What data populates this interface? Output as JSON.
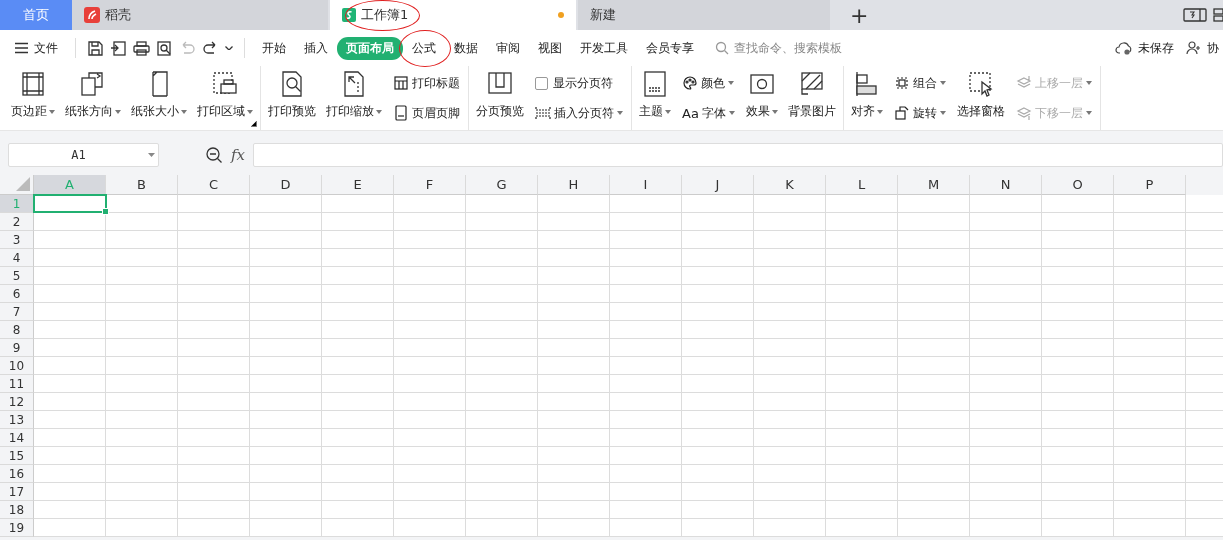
{
  "tabs": [
    {
      "kind": "home",
      "label": "首页",
      "selected": false
    },
    {
      "kind": "app",
      "label": "稻壳",
      "selected": false
    },
    {
      "kind": "doc",
      "label": "工作簿1",
      "selected": true,
      "circled": true,
      "unsaved": true
    },
    {
      "kind": "plain",
      "label": "新建",
      "selected": false
    }
  ],
  "new_tab_button": "+",
  "menu": {
    "file": "文件",
    "quick_access": [
      {
        "disabled": false
      },
      {
        "disabled": false
      },
      {
        "disabled": false
      },
      {
        "disabled": false
      },
      {
        "disabled": true
      },
      {
        "disabled": false
      },
      {
        "disabled": false
      }
    ],
    "items": [
      {
        "label": "开始",
        "selected": false,
        "circled": false
      },
      {
        "label": "插入",
        "selected": false,
        "circled": false
      },
      {
        "label": "页面布局",
        "selected": true,
        "circled": false
      },
      {
        "label": "公式",
        "selected": false,
        "circled": true
      },
      {
        "label": "数据",
        "selected": false,
        "circled": false
      },
      {
        "label": "审阅",
        "selected": false,
        "circled": false
      },
      {
        "label": "视图",
        "selected": false,
        "circled": false
      },
      {
        "label": "开发工具",
        "selected": false,
        "circled": false
      },
      {
        "label": "会员专享",
        "selected": false,
        "circled": false
      }
    ],
    "search": {
      "placeholder": "查找命令、搜索模板"
    },
    "save_status": "未保存",
    "share": "协"
  },
  "ribbon": [
    {
      "launcher": true,
      "items": [
        {
          "kind": "large",
          "label": "页边距",
          "dropdown": true
        },
        {
          "kind": "large",
          "label": "纸张方向",
          "dropdown": true
        },
        {
          "kind": "large",
          "label": "纸张大小",
          "dropdown": true
        },
        {
          "kind": "large",
          "label": "打印区域",
          "dropdown": true
        }
      ]
    },
    {
      "items": [
        {
          "kind": "large",
          "label": "打印预览",
          "dropdown": false
        },
        {
          "kind": "large",
          "label": "打印缩放",
          "dropdown": true
        },
        {
          "kind": "stack",
          "items": [
            {
              "kind": "small",
              "label": "打印标题",
              "dropdown": false,
              "disabled": false
            },
            {
              "kind": "small",
              "label": "页眉页脚",
              "dropdown": false,
              "disabled": false
            }
          ]
        }
      ]
    },
    {
      "items": [
        {
          "kind": "large",
          "label": "分页预览",
          "dropdown": false
        },
        {
          "kind": "stack",
          "items": [
            {
              "kind": "check",
              "label": "显示分页符",
              "checked": false
            },
            {
              "kind": "small",
              "label": "插入分页符",
              "dropdown": true,
              "disabled": false
            }
          ]
        }
      ]
    },
    {
      "items": [
        {
          "kind": "large",
          "label": "主题",
          "dropdown": true
        },
        {
          "kind": "stack",
          "items": [
            {
              "kind": "small",
              "label": "颜色",
              "dropdown": true,
              "disabled": false
            },
            {
              "kind": "glyph",
              "glyph": "Aa",
              "label": "字体",
              "dropdown": true
            }
          ]
        },
        {
          "kind": "large",
          "label": "效果",
          "dropdown": true
        },
        {
          "kind": "large",
          "label": "背景图片",
          "dropdown": false
        }
      ]
    },
    {
      "items": [
        {
          "kind": "large",
          "label": "对齐",
          "dropdown": true
        },
        {
          "kind": "stack",
          "items": [
            {
              "kind": "small",
              "label": "组合",
              "dropdown": true,
              "disabled": false
            },
            {
              "kind": "small",
              "label": "旋转",
              "dropdown": true,
              "disabled": false
            }
          ]
        },
        {
          "kind": "large",
          "label": "选择窗格",
          "dropdown": false
        },
        {
          "kind": "stack",
          "items": [
            {
              "kind": "small",
              "label": "上移一层",
              "dropdown": true,
              "disabled": true
            },
            {
              "kind": "small",
              "label": "下移一层",
              "dropdown": true,
              "disabled": true
            }
          ]
        }
      ]
    }
  ],
  "formula_bar": {
    "name_box": "A1",
    "fx": "fx"
  },
  "sheet": {
    "columns": [
      {
        "label": "A",
        "selected": true
      },
      {
        "label": "B",
        "selected": false
      },
      {
        "label": "C",
        "selected": false
      },
      {
        "label": "D",
        "selected": false
      },
      {
        "label": "E",
        "selected": false
      },
      {
        "label": "F",
        "selected": false
      },
      {
        "label": "G",
        "selected": false
      },
      {
        "label": "H",
        "selected": false
      },
      {
        "label": "I",
        "selected": false
      },
      {
        "label": "J",
        "selected": false
      },
      {
        "label": "K",
        "selected": false
      },
      {
        "label": "L",
        "selected": false
      },
      {
        "label": "M",
        "selected": false
      },
      {
        "label": "N",
        "selected": false
      },
      {
        "label": "O",
        "selected": false
      },
      {
        "label": "P",
        "selected": false
      }
    ],
    "rows": [
      {
        "label": "1",
        "selected": true
      },
      {
        "label": "2",
        "selected": false
      },
      {
        "label": "3",
        "selected": false
      },
      {
        "label": "4",
        "selected": false
      },
      {
        "label": "5",
        "selected": false
      },
      {
        "label": "6",
        "selected": false
      },
      {
        "label": "7",
        "selected": false
      },
      {
        "label": "8",
        "selected": false
      },
      {
        "label": "9",
        "selected": false
      },
      {
        "label": "10",
        "selected": false
      },
      {
        "label": "11",
        "selected": false
      },
      {
        "label": "12",
        "selected": false
      },
      {
        "label": "13",
        "selected": false
      },
      {
        "label": "14",
        "selected": false
      },
      {
        "label": "15",
        "selected": false
      },
      {
        "label": "16",
        "selected": false
      },
      {
        "label": "17",
        "selected": false
      },
      {
        "label": "18",
        "selected": false
      },
      {
        "label": "19",
        "selected": false
      }
    ]
  }
}
